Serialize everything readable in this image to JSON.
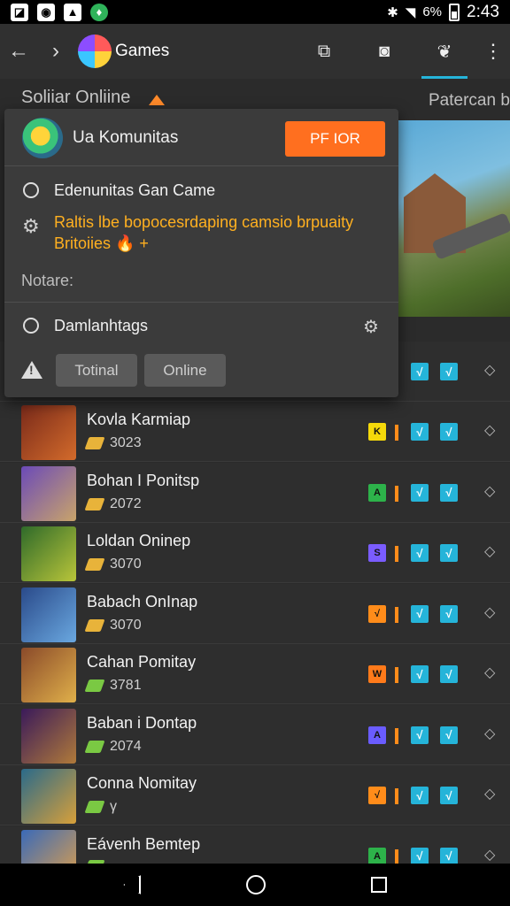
{
  "status_bar": {
    "battery_text": "6%",
    "time": "2:43",
    "left_icons": [
      "notification-icon",
      "chat-icon",
      "image-icon",
      "app-icon"
    ]
  },
  "app_bar": {
    "back_glyph": "←",
    "forward_glyph": "›",
    "title": "Games"
  },
  "sub_header": {
    "title": "Soliiar Onliine",
    "tab": "Patercan b"
  },
  "dialog": {
    "title": "Ua Komunitas",
    "primary_button": "PF IOR",
    "option1": "Edenunitas Gan Came",
    "warning_text": "Raltis lbe bopocesrdaping camsio brpuaity Britoiies 🔥 +",
    "notes_label": "Notare:",
    "option2": "Damlanhtags",
    "button_one": "Totinal",
    "button_two": "Online"
  },
  "games": [
    {
      "name": "Kovla Karmiap",
      "meta": "3023",
      "badge": "K",
      "badge_color": "#f5d90a",
      "tag": "gold",
      "thumb": [
        "#7a2a1a",
        "#d36b2b"
      ]
    },
    {
      "name": "Bohan I Ponitsp",
      "meta": "2072",
      "badge": "A",
      "badge_color": "#2db24a",
      "tag": "gold",
      "thumb": [
        "#6b4ab8",
        "#c9a46a"
      ]
    },
    {
      "name": "Loldan Oninep",
      "meta": "3070",
      "badge": "S",
      "badge_color": "#7a5cff",
      "tag": "gold",
      "thumb": [
        "#2f6a2a",
        "#b9c53a"
      ]
    },
    {
      "name": "Babach OnInap",
      "meta": "3070",
      "badge": "√",
      "badge_color": "#ff8c1a",
      "tag": "gold",
      "thumb": [
        "#2a4a8a",
        "#6aa8e0"
      ]
    },
    {
      "name": "Cahan Pomitay",
      "meta": "3781",
      "badge": "W",
      "badge_color": "#ff7a1a",
      "tag": "green",
      "thumb": [
        "#8a4a2a",
        "#e0b04a"
      ]
    },
    {
      "name": "Baban i Dontap",
      "meta": "2074",
      "badge": "A",
      "badge_color": "#6a5cff",
      "tag": "green",
      "thumb": [
        "#3a1a5a",
        "#b07a3a"
      ]
    },
    {
      "name": "Conna Nomitay",
      "meta": "γ",
      "badge": "√",
      "badge_color": "#ff8c1a",
      "tag": "green",
      "thumb": [
        "#2a6a8a",
        "#d8a03a"
      ]
    },
    {
      "name": "Eávenh Bemtep",
      "meta": "",
      "badge": "A",
      "badge_color": "#2db24a",
      "tag": "green",
      "thumb": [
        "#3a6ab8",
        "#e0a04a"
      ]
    }
  ],
  "list_prefix_rows": [
    {
      "check_glyph": "√"
    }
  ],
  "check_glyph": "√",
  "row_gear_glyph": "◇"
}
